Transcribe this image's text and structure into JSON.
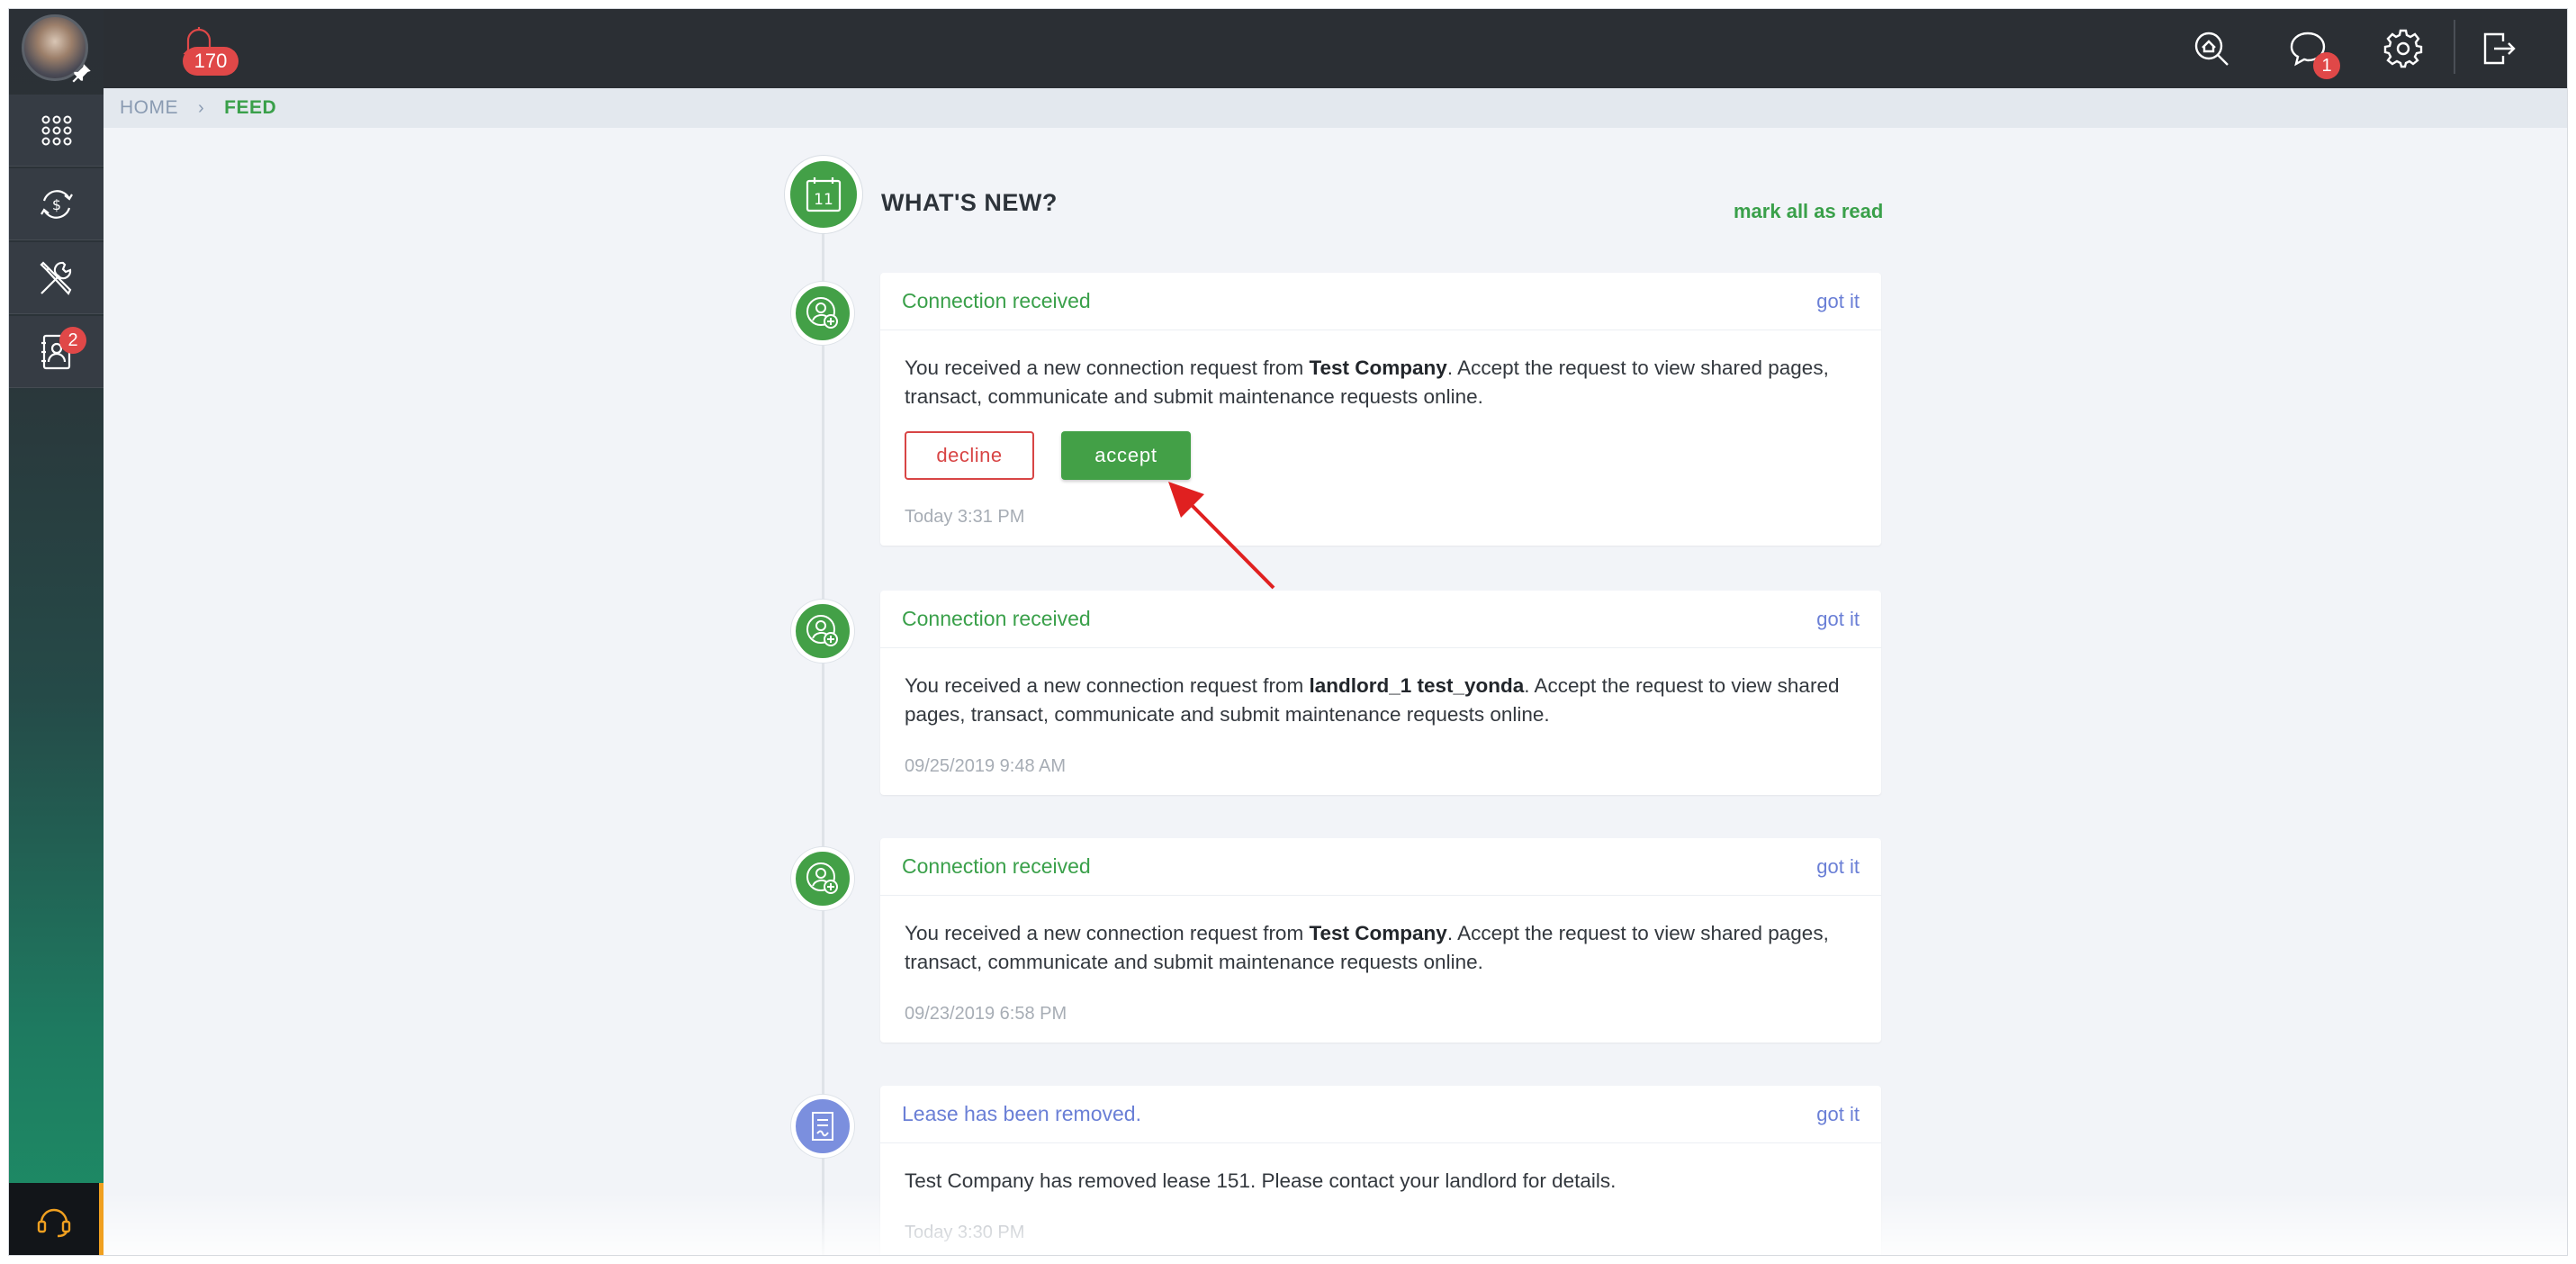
{
  "topbar": {
    "notifications_count": "170",
    "messages_count": "1"
  },
  "sidebar": {
    "contacts_badge": "2",
    "items": [
      {
        "icon": "apps-grid-icon"
      },
      {
        "icon": "transactions-icon"
      },
      {
        "icon": "tools-icon"
      },
      {
        "icon": "contacts-icon"
      }
    ],
    "support_icon": "headset-icon"
  },
  "breadcrumb": {
    "home": "HOME",
    "current": "FEED"
  },
  "feed": {
    "title": "WHAT'S NEW?",
    "header_icon_day": "11",
    "mark_all_label": "mark all as read",
    "items": [
      {
        "title": "Connection received",
        "dismiss": "got it",
        "msg_before": "You received a new connection request from ",
        "msg_bold": "Test Company",
        "msg_after": ". Accept the request to view shared pages, transact, communicate and submit maintenance requests online.",
        "decline_label": "decline",
        "accept_label": "accept",
        "time": "Today 3:31 PM"
      },
      {
        "title": "Connection received",
        "dismiss": "got it",
        "msg_before": "You received a new connection request from ",
        "msg_bold": "landlord_1 test_yonda",
        "msg_after": ". Accept the request to view shared pages, transact, communicate and submit maintenance requests online.",
        "time": "09/25/2019 9:48 AM"
      },
      {
        "title": "Connection received",
        "dismiss": "got it",
        "msg_before": "You received a new connection request from ",
        "msg_bold": "Test Company",
        "msg_after": ". Accept the request to view shared pages, transact, communicate and submit maintenance requests online.",
        "time": "09/23/2019 6:58 PM"
      },
      {
        "title": "Lease has been removed.",
        "dismiss": "got it",
        "msg_before": "Test Company has removed lease 151. Please contact your landlord for details.",
        "time": "Today 3:30 PM"
      }
    ]
  },
  "colors": {
    "accent_green": "#43a047",
    "accent_purple": "#7b8fde",
    "danger_red": "#d84545",
    "topbar_dark": "#2b2f34"
  }
}
